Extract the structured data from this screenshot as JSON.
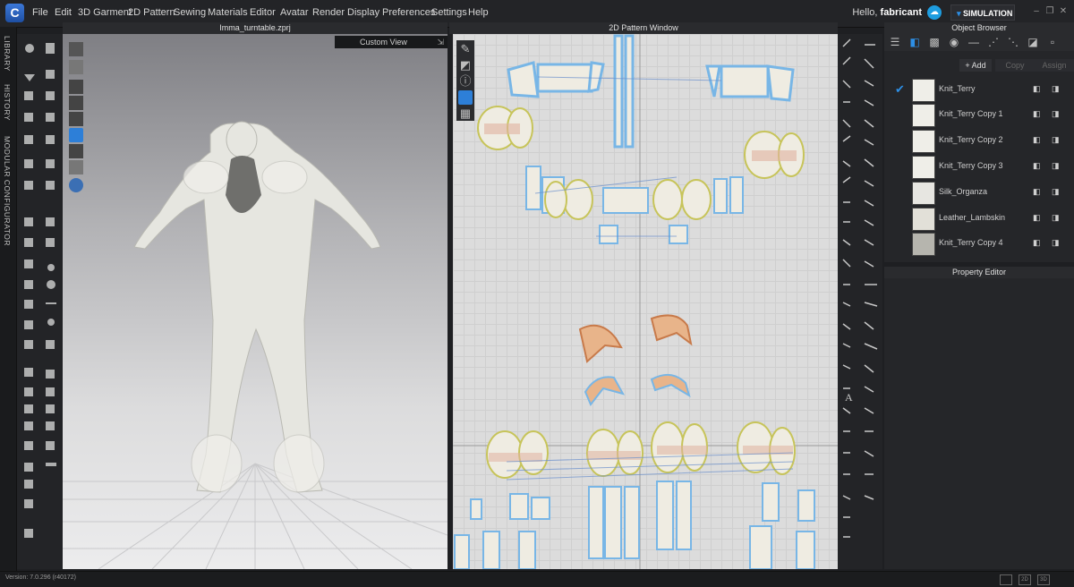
{
  "app": {
    "menus": [
      "File",
      "Edit",
      "3D Garment",
      "2D Pattern",
      "Sewing",
      "Materials",
      "Editor",
      "Avatar",
      "Render",
      "Display",
      "Preferences",
      "Settings",
      "Help"
    ],
    "greeting": "Hello,",
    "username": "fabricant",
    "mode_button": "SIMULATION",
    "accent_color": "#2d8fe6"
  },
  "side_tabs": [
    "LIBRARY",
    "HISTORY",
    "MODULAR CONFIGURATOR"
  ],
  "viewport_3d": {
    "title": "Imma_turntable.zprj",
    "view_label": "Custom View"
  },
  "pattern_window": {
    "title": "2D Pattern Window"
  },
  "object_browser": {
    "title": "Object Browser",
    "add_label": "+ Add",
    "copy_label": "Copy",
    "assign_label": "Assign",
    "materials": [
      {
        "name": "Knit_Terry",
        "selected": true
      },
      {
        "name": "Knit_Terry Copy 1"
      },
      {
        "name": "Knit_Terry Copy 2"
      },
      {
        "name": "Knit_Terry Copy 3"
      },
      {
        "name": "Silk_Organza"
      },
      {
        "name": "Leather_Lambskin"
      },
      {
        "name": "Knit_Terry Copy 4"
      }
    ]
  },
  "property_editor": {
    "title": "Property Editor"
  },
  "status": {
    "version": "Version: 7.0.296 (r40172)",
    "view_buttons": [
      "",
      "2D",
      "3D"
    ]
  }
}
